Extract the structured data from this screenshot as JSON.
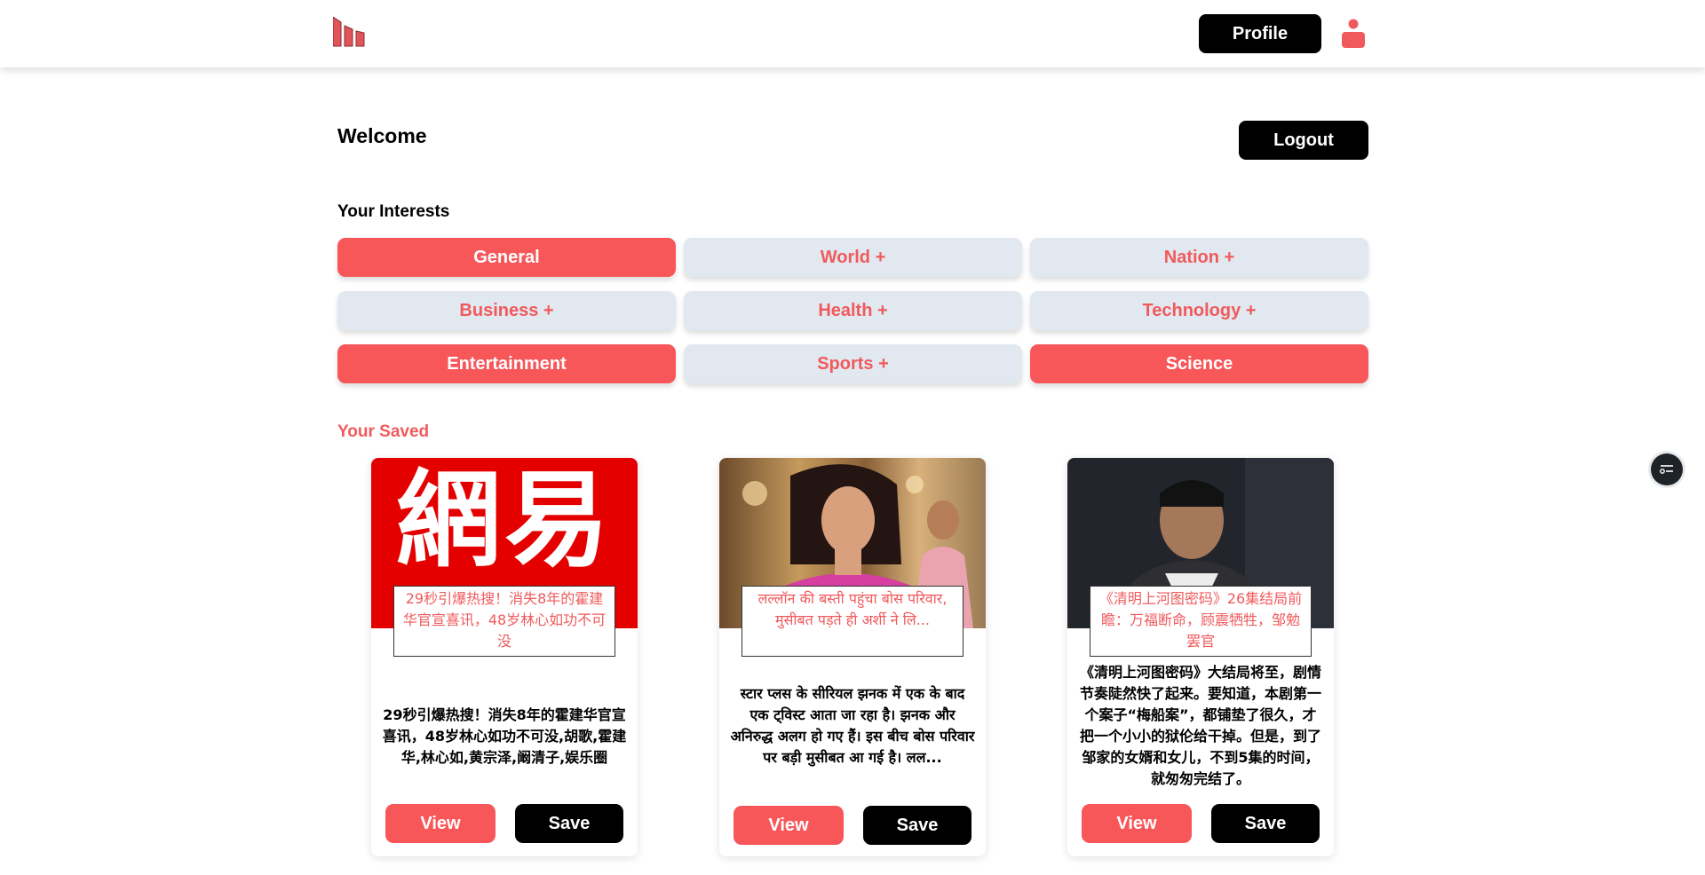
{
  "header": {
    "logo_icon": "bar-logo-icon",
    "profile_label": "Profile",
    "user_icon": "user-icon",
    "accent": "#f8575a"
  },
  "welcome": {
    "title": "Welcome",
    "logout_label": "Logout"
  },
  "interests": {
    "title": "Your Interests",
    "items": [
      {
        "label": "General",
        "selected": true
      },
      {
        "label": "World +",
        "selected": false
      },
      {
        "label": "Nation +",
        "selected": false
      },
      {
        "label": "Business +",
        "selected": false
      },
      {
        "label": "Health +",
        "selected": false
      },
      {
        "label": "Technology +",
        "selected": false
      },
      {
        "label": "Entertainment",
        "selected": true
      },
      {
        "label": "Sports +",
        "selected": false
      },
      {
        "label": "Science",
        "selected": true
      }
    ]
  },
  "saved": {
    "title": "Your Saved",
    "cards": [
      {
        "image_text": "網易",
        "title": "29秒引爆热搜！消失8年的霍建华官宣喜讯，48岁林心如功不可没",
        "description": "29秒引爆热搜！消失8年的霍建华官宣喜讯，48岁林心如功不可没,胡歌,霍建华,林心如,黄宗泽,阚清子,娱乐圈",
        "view_label": "View",
        "save_label": "Save"
      },
      {
        "image_text": "",
        "title": "लल्लॉन की बस्ती पहुंचा बोस परिवार, मुसीबत पड़ते ही अर्शी ने लि...",
        "description": "स्टार प्लस के सीरियल झनक में एक के बाद एक ट्विस्ट आता जा रहा है। झनक और अनिरुद्ध अलग हो गए हैं। इस बीच बोस परिवार पर बड़ी मुसीबत आ गई है। लल...",
        "view_label": "View",
        "save_label": "Save"
      },
      {
        "image_text": "",
        "title": "《清明上河图密码》26集结局前瞻：万福断命，顾震牺牲，邹勉罢官",
        "description": "《清明上河图密码》大结局将至，剧情节奏陡然快了起来。要知道，本剧第一个案子“梅船案”，都铺垫了很久，才把一个小小的狱伦给干掉。但是，到了邹家的女婿和女儿，不到5集的时间，就匆匆完结了。",
        "view_label": "View",
        "save_label": "Save"
      }
    ]
  },
  "floating": {
    "icon": "filter-settings-icon"
  }
}
